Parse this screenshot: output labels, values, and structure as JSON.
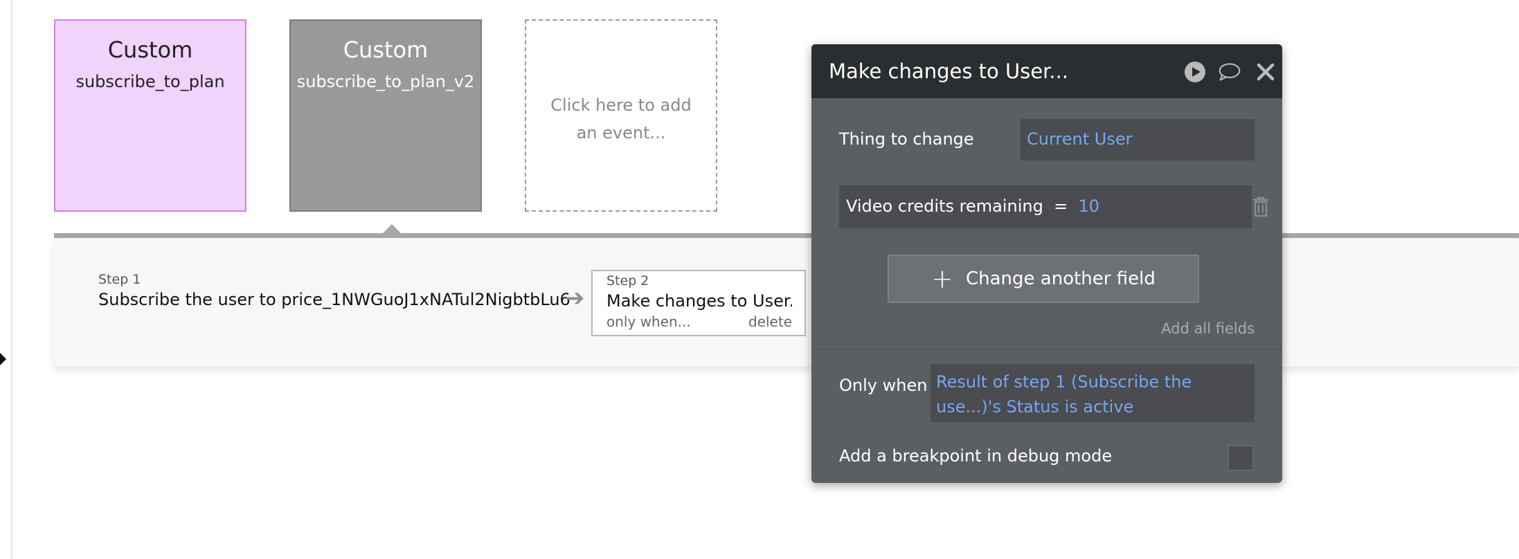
{
  "events": [
    {
      "title": "Custom",
      "subtitle": "subscribe_to_plan"
    },
    {
      "title": "Custom",
      "subtitle": "subscribe_to_plan_v2"
    },
    {
      "add_text": "Click here to add an event..."
    }
  ],
  "steps": [
    {
      "label": "Step 1",
      "name": "Subscribe the user to price_1NWGuoJ1xNATul2NigbtbLu6"
    },
    {
      "label": "Step 2",
      "name": "Make changes to User...",
      "only_when": "only when...",
      "delete": "delete"
    }
  ],
  "popup": {
    "title": "Make changes to User...",
    "thing_to_change": {
      "label": "Thing to change",
      "value": "Current User"
    },
    "field": {
      "name": "Video credits remaining",
      "operator": "=",
      "value": "10"
    },
    "change_button": {
      "icon": "+",
      "label": "Change another field"
    },
    "add_all_fields": "Add all fields",
    "only_when": {
      "label": "Only when",
      "value": " Result of step 1 (Subscribe the use...)'s Status is active"
    },
    "breakpoint_label": "Add a breakpoint in debug mode"
  },
  "colors": {
    "selected_event": "#f0d4fb",
    "active_event": "#999999",
    "popup_bg": "#5c5f62",
    "popup_header": "#2b2e30",
    "link_blue": "#74a7f2"
  },
  "icons": [
    "play-icon",
    "comment-icon",
    "close-icon",
    "trash-icon",
    "arrow-right-icon",
    "plus-icon"
  ]
}
